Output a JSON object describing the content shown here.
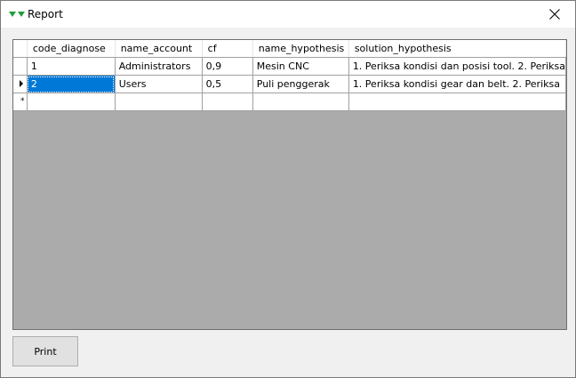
{
  "window": {
    "title": "Report",
    "icon": "green-triangles-icon"
  },
  "grid": {
    "columns": [
      "code_diagnose",
      "name_account",
      "cf",
      "name_hypothesis",
      "solution_hypothesis"
    ],
    "rows": [
      {
        "code_diagnose": "1",
        "name_account": "Administrators",
        "cf": "0,9",
        "name_hypothesis": "Mesin CNC",
        "solution_hypothesis": "1. Periksa kondisi dan posisi tool. 2. Periksa"
      },
      {
        "code_diagnose": "2",
        "name_account": "Users",
        "cf": "0,5",
        "name_hypothesis": "Puli penggerak",
        "solution_hypothesis": "1. Periksa kondisi gear dan belt. 2. Periksa"
      }
    ],
    "current_row_marker": "▸",
    "new_row_marker": "*",
    "selected_cell": "row 2, code_diagnose"
  },
  "buttons": {
    "print_label": "Print"
  },
  "colors": {
    "grid_background": "#ababab",
    "selection": "#0078d7",
    "icon_green": "#1e9e3a"
  }
}
